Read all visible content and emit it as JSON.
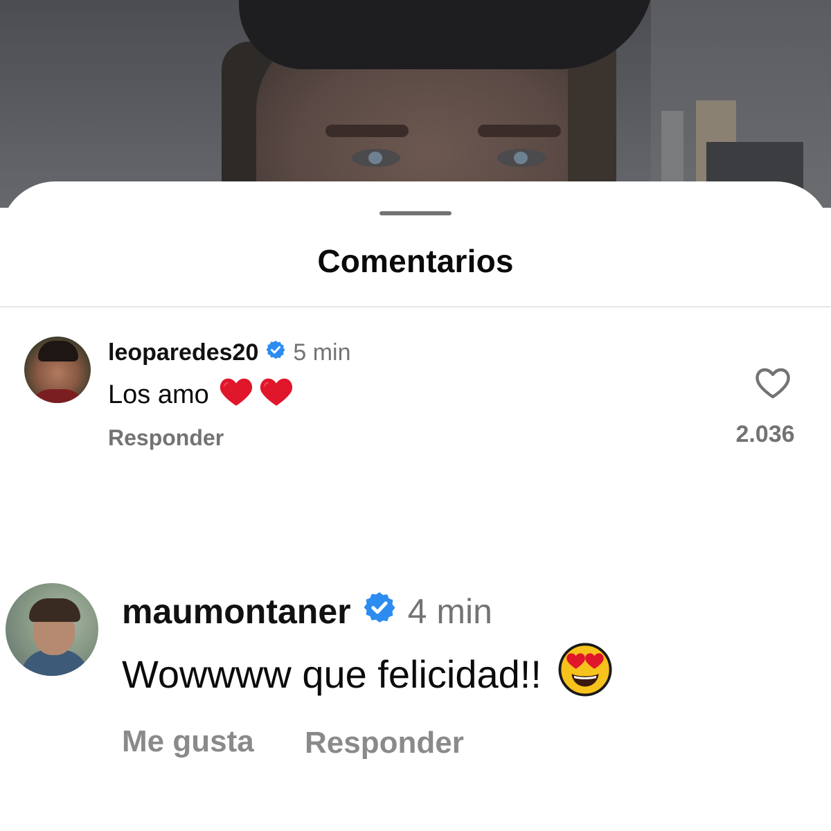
{
  "sheet": {
    "title": "Comentarios"
  },
  "comments": [
    {
      "username": "leoparedes20",
      "verified": true,
      "time": "5 min",
      "text": "Los amo",
      "emojis": [
        "red-heart-emoji",
        "red-heart-emoji"
      ],
      "reply_label": "Responder",
      "like_count": "2.036"
    },
    {
      "username": "maumontaner",
      "verified": true,
      "time": "4 min",
      "text": "Wowwww que felicidad!!",
      "emojis": [
        "heart-eyes-emoji"
      ],
      "like_label": "Me gusta",
      "reply_label": "Responder"
    }
  ],
  "colors": {
    "verified_badge": "#2d8cf0",
    "secondary_text": "#737373",
    "primary_text": "#0b0b0b",
    "heart_emoji": "#e0162b"
  },
  "icons": [
    "heart-outline-icon",
    "verified-badge-icon"
  ]
}
